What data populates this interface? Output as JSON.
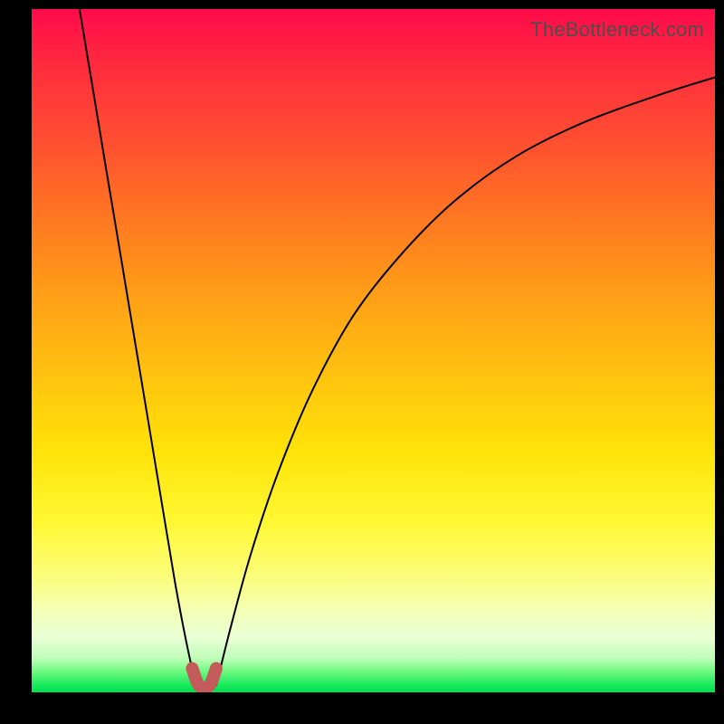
{
  "watermark": {
    "text": "TheBottleneck.com"
  },
  "colors": {
    "frame_bg_top": "#ff0a4a",
    "frame_bg_bottom": "#00e04f",
    "curve_stroke": "#000000",
    "nub_stroke": "#c45a5a",
    "page_bg": "#000000"
  },
  "chart_data": {
    "type": "line",
    "title": "",
    "xlabel": "",
    "ylabel": "",
    "xlim": [
      0,
      100
    ],
    "ylim": [
      0,
      100
    ],
    "grid": false,
    "legend": false,
    "notes": "Two V-shaped bottleneck curves meeting near x≈25; values estimated from pixel positions on a 0–100 normalized plot area. y=0 at bottom (green), y=100 at top (red).",
    "series": [
      {
        "name": "left-curve",
        "x": [
          7,
          9,
          11,
          13,
          15,
          17,
          19,
          21,
          22.5,
          24
        ],
        "y": [
          100,
          88,
          76,
          64,
          52,
          40,
          28,
          16,
          8,
          1
        ]
      },
      {
        "name": "right-curve",
        "x": [
          27,
          29,
          32,
          36,
          41,
          47,
          54,
          62,
          71,
          81,
          92,
          100
        ],
        "y": [
          1,
          9,
          20,
          32,
          44,
          55,
          64,
          72,
          78.5,
          83.5,
          87.5,
          90
        ]
      },
      {
        "name": "minimum-marker",
        "x": [
          23.5,
          24.5,
          26,
          27
        ],
        "y": [
          3.5,
          1,
          1,
          3.5
        ]
      }
    ]
  }
}
